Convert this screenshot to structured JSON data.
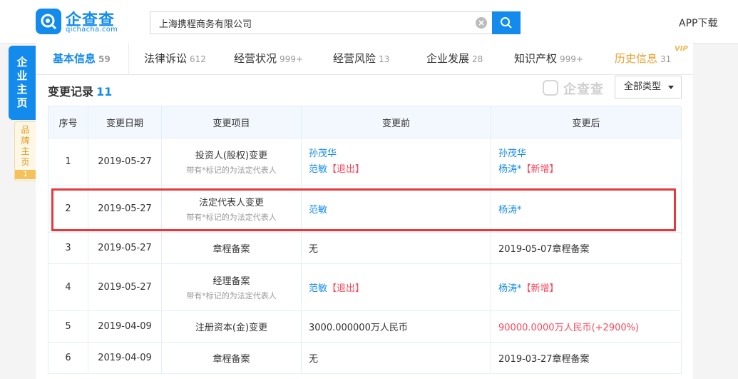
{
  "brand": {
    "name": "企查查",
    "domain": "qichacha.com"
  },
  "search": {
    "value": "上海携程商务有限公司"
  },
  "header": {
    "app_download": "APP下载"
  },
  "side_nav": {
    "main": [
      "企",
      "业",
      "主",
      "页"
    ],
    "brand": [
      "品",
      "牌",
      "主",
      "页"
    ],
    "brand_count": "1"
  },
  "tabs": [
    {
      "label": "基本信息",
      "count": "59"
    },
    {
      "label": "法律诉讼",
      "count": "612"
    },
    {
      "label": "经营状况",
      "count": "999+"
    },
    {
      "label": "经营风险",
      "count": "13"
    },
    {
      "label": "企业发展",
      "count": "28"
    },
    {
      "label": "知识产权",
      "count": "999+"
    },
    {
      "label": "历史信息",
      "count": "31"
    }
  ],
  "vip_badge": "VIP",
  "section": {
    "title": "变更记录",
    "count": "11",
    "watermark": "企查查",
    "filter": "全部类型"
  },
  "table": {
    "headers": [
      "序号",
      "变更日期",
      "变更项目",
      "变更前",
      "变更后"
    ],
    "rows": [
      {
        "no": "1",
        "date": "2019-05-27",
        "item": "投资人(股权)变更",
        "note": "带有*标记的为法定代表人",
        "before": [
          {
            "name": "孙茂华",
            "tag": ""
          },
          {
            "name": "范敏",
            "tag": "【退出】"
          }
        ],
        "after": [
          {
            "name": "孙茂华",
            "tag": ""
          },
          {
            "name": "杨涛*",
            "tag": "【新增】"
          }
        ]
      },
      {
        "no": "2",
        "date": "2019-05-27",
        "item": "法定代表人变更",
        "note": "带有*标记的为法定代表人",
        "before": [
          {
            "name": "范敏",
            "tag": ""
          }
        ],
        "after": [
          {
            "name": "杨涛*",
            "tag": ""
          }
        ]
      },
      {
        "no": "3",
        "date": "2019-05-27",
        "item": "章程备案",
        "before_text": "无",
        "after_text": "2019-05-07章程备案"
      },
      {
        "no": "4",
        "date": "2019-05-27",
        "item": "经理备案",
        "note": "带有*标记的为法定代表人",
        "before": [
          {
            "name": "范敏",
            "tag": "【退出】"
          }
        ],
        "after": [
          {
            "name": "杨涛*",
            "tag": "【新增】"
          }
        ]
      },
      {
        "no": "5",
        "date": "2019-04-09",
        "item": "注册资本(金)变更",
        "before_text": "3000.000000万人民币",
        "after_text": "90000.0000万人民币",
        "after_extra": "(+2900%)"
      },
      {
        "no": "6",
        "date": "2019-04-09",
        "item": "章程备案",
        "before_text": "无",
        "after_text": "2019-03-27章程备案"
      }
    ]
  },
  "colors": {
    "accent": "#128bed",
    "alert": "#fd485e",
    "highlight_box": "#e8383d",
    "history_tab": "#e5a030"
  }
}
